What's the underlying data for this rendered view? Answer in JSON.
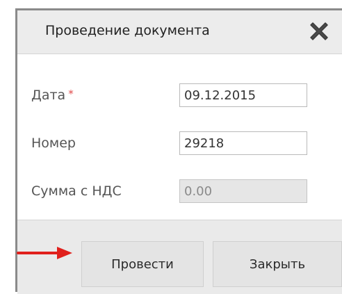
{
  "dialog": {
    "title": "Проведение документа",
    "close_icon": "close-x-icon"
  },
  "form": {
    "date": {
      "label": "Дата",
      "required_mark": "*",
      "value": "09.12.2015"
    },
    "number": {
      "label": "Номер",
      "value": "29218"
    },
    "sum": {
      "label": "Сумма с НДС",
      "value": "0.00",
      "disabled": true
    }
  },
  "buttons": {
    "post_label": "Провести",
    "close_label": "Закрыть"
  },
  "annotation": {
    "arrow_icon": "red-arrow-icon",
    "arrow_color": "#e0201c"
  },
  "colors": {
    "required": "#e04a4a",
    "dialog_bg": "#eaeaea"
  }
}
